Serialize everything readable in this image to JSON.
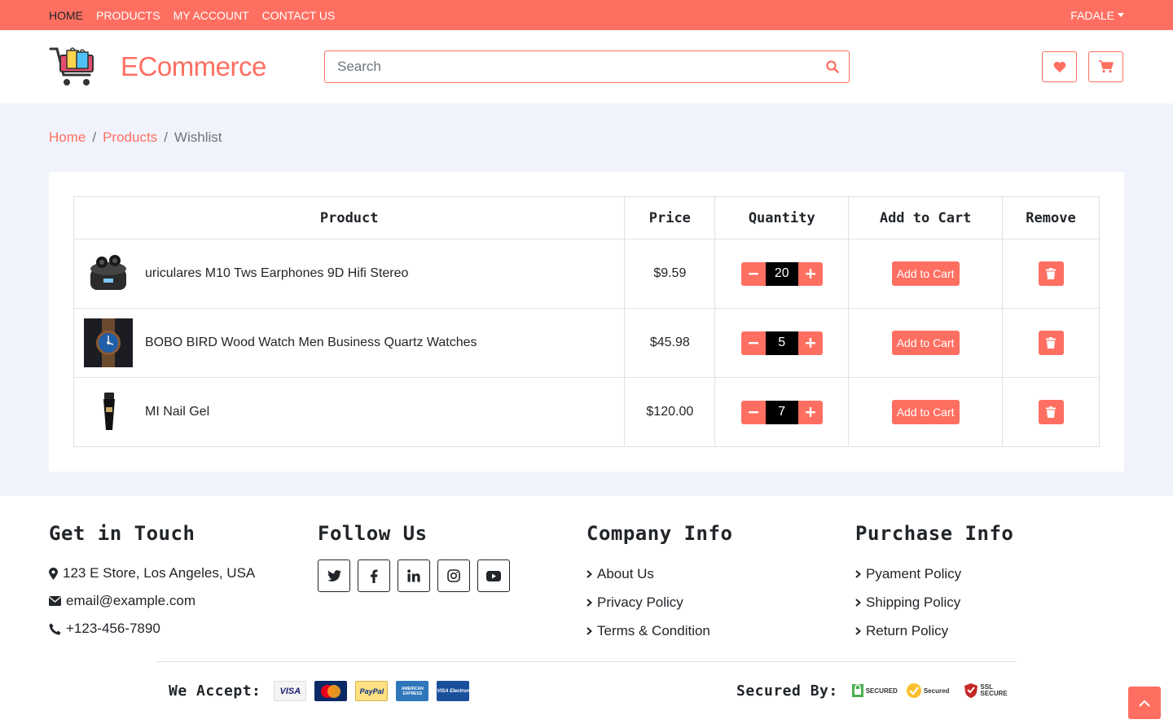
{
  "topnav": {
    "items": [
      {
        "label": "HOME"
      },
      {
        "label": "PRODUCTS"
      },
      {
        "label": "MY ACCOUNT"
      },
      {
        "label": "CONTACT US"
      }
    ],
    "user": "FADALE"
  },
  "header": {
    "brand": "ECommerce",
    "search_placeholder": "Search"
  },
  "breadcrumb": {
    "home": "Home",
    "products": "Products",
    "current": "Wishlist",
    "separator": "/"
  },
  "table": {
    "headers": {
      "product": "Product",
      "price": "Price",
      "quantity": "Quantity",
      "add_to_cart": "Add to Cart",
      "remove": "Remove"
    },
    "rows": [
      {
        "name": "uriculares M10 Tws Earphones 9D Hifi Stereo",
        "price": "$9.59",
        "qty": "20",
        "action": "Add to Cart"
      },
      {
        "name": "BOBO BIRD Wood Watch Men Business Quartz Watches",
        "price": "$45.98",
        "qty": "5",
        "action": "Add to Cart"
      },
      {
        "name": "MI Nail Gel",
        "price": "$120.00",
        "qty": "7",
        "action": "Add to Cart"
      }
    ]
  },
  "footer": {
    "touch": {
      "title": "Get in Touch",
      "address": "123 E Store, Los Angeles, USA",
      "email": "email@example.com",
      "phone": "+123-456-7890"
    },
    "follow": {
      "title": "Follow Us",
      "icons": [
        "twitter-icon",
        "facebook-icon",
        "linkedin-icon",
        "instagram-icon",
        "youtube-icon"
      ]
    },
    "company": {
      "title": "Company Info",
      "links": [
        "About Us",
        "Privacy Policy",
        "Terms & Condition"
      ]
    },
    "purchase": {
      "title": "Purchase Info",
      "links": [
        "Pyament Policy",
        "Shipping Policy",
        "Return Policy"
      ]
    },
    "accept_label": "We Accept:",
    "cards": {
      "visa": "VISA",
      "mastercard": "MasterCard",
      "paypal": "PayPal",
      "amex": "AMERICAN EXPRESS",
      "visa_electron": "VISA Electron"
    },
    "secured_label": "Secured By:",
    "badges": {
      "secured": "SECURED",
      "paypal_secured": "Secured",
      "ssl": "SSL SECURE"
    }
  },
  "colors": {
    "accent": "#ff6f61",
    "main_bg": "#f1f3fc"
  }
}
